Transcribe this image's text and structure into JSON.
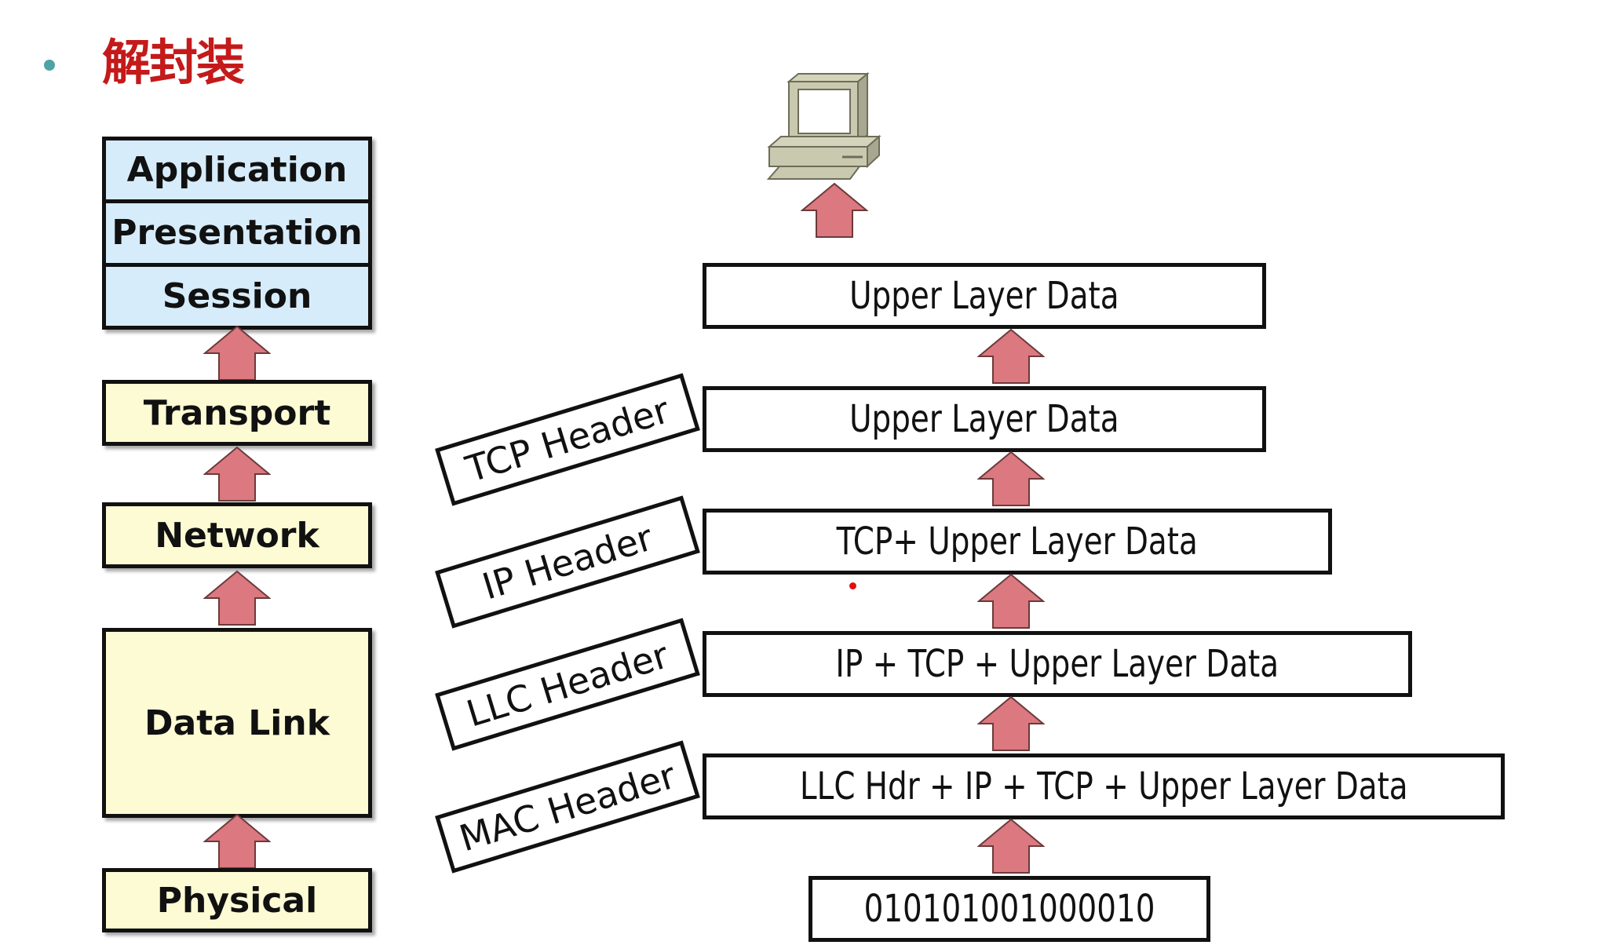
{
  "title": {
    "bullet_color": "#4fa3a5",
    "text": "解封装",
    "color": "#c41a1a"
  },
  "osi_layers": {
    "upper": [
      "Application",
      "Presentation",
      "Session"
    ],
    "transport": "Transport",
    "network": "Network",
    "data_link": "Data Link",
    "physical": "Physical"
  },
  "headers": {
    "tcp": "TCP Header",
    "ip": "IP Header",
    "llc": "LLC Header",
    "mac": "MAC Header"
  },
  "frames": {
    "application": "Upper Layer Data",
    "transport": "Upper Layer Data",
    "network": "TCP+ Upper Layer Data",
    "llc": "IP + TCP + Upper Layer Data",
    "mac": "LLC Hdr + IP + TCP + Upper Layer Data",
    "bits": "010101001000010"
  },
  "colors": {
    "upper_layer_fill": "#d6ecfb",
    "lower_layer_fill": "#fcfbd4",
    "arrow_fill": "#db7880"
  },
  "icons": {
    "host": "desktop-computer-icon",
    "arrow": "up-arrow-icon"
  }
}
